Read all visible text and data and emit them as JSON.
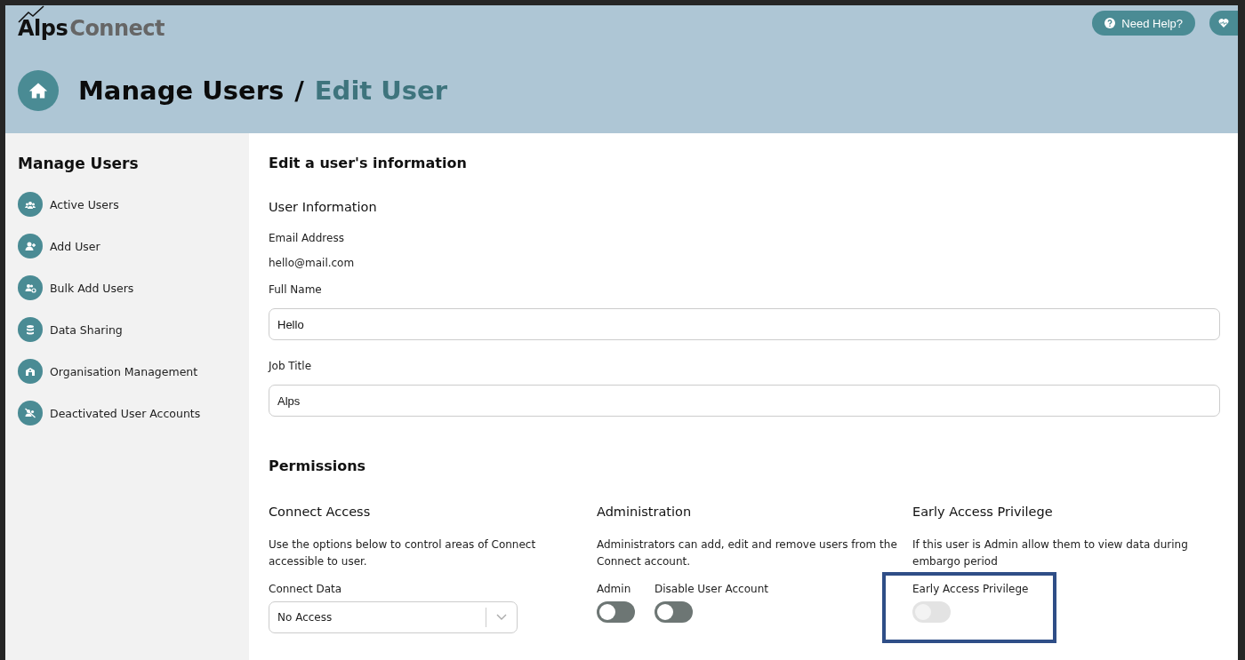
{
  "logo": {
    "part_1": "Alps",
    "part_2": "Connect"
  },
  "header_buttons": [
    {
      "kind": "help",
      "label": "Need Help?"
    },
    {
      "kind": "heart"
    }
  ],
  "breadcrumb": {
    "parent": "Manage Users",
    "separator": "/",
    "current": "Edit User"
  },
  "sidebar": {
    "title": "Manage Users",
    "items": [
      {
        "label": "Active Users"
      },
      {
        "label": "Add User"
      },
      {
        "label": "Bulk Add Users"
      },
      {
        "label": "Data Sharing"
      },
      {
        "label": "Organisation Management"
      },
      {
        "label": "Deactivated User Accounts"
      }
    ]
  },
  "form": {
    "title": "Edit a user's information",
    "section": "User Information",
    "email_label": "Email Address",
    "email_value": "hello@mail.com",
    "fields": [
      {
        "label": "Full Name",
        "value": "Hello"
      },
      {
        "label": "Job Title",
        "value": "Alps"
      }
    ]
  },
  "permissions": {
    "title": "Permissions",
    "columns": [
      {
        "title": "Connect Access",
        "text": "Use the options below to control areas of Connect accessible to user.",
        "controls": [
          {
            "kind": "select",
            "label": "Connect Data",
            "value": "No Access"
          }
        ]
      },
      {
        "title": "Administration",
        "text": "Administrators can add, edit and remove users from the Connect account.",
        "controls": [
          {
            "kind": "toggle",
            "label": "Admin",
            "on": false,
            "disabled": false
          },
          {
            "kind": "toggle",
            "label": "Disable User Account",
            "on": false,
            "disabled": false
          }
        ]
      },
      {
        "title": "Early Access Privilege",
        "text": "If this user is Admin allow them to view data during embargo period",
        "highlighted": true,
        "controls": [
          {
            "kind": "toggle",
            "label": "Early Access Privilege",
            "on": false,
            "disabled": true
          }
        ]
      }
    ]
  }
}
